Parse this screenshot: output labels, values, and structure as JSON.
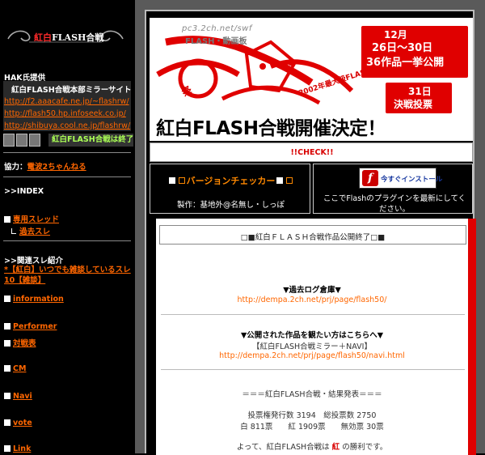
{
  "sidebar": {
    "logo_text_red": "紅白",
    "logo_text": "FLASH合戦",
    "provider": "HAK氏提供",
    "mirror_title": "紅白FLASH合戦本部ミラーサイト",
    "mirror_links": [
      "http://f2.aaacafe.ne.jp/~flashrw/",
      "http://flash50.hp.infoseek.co.jp/",
      "http://shibuya.cool.ne.jp/flashrw/"
    ],
    "ticker": "紅白FLASH合戦は終了しました",
    "cooperation_label": "協力：",
    "cooperation_link": "電波2ちゃんねる",
    "index_heading": ">>INDEX",
    "thread_item": "専用スレッド",
    "thread_sub": "過去スレ",
    "related_heading": ">>関連スレ紹介",
    "related_link": "*【紅白】いつでも雑談しているスレ10【雑談】",
    "nav_items": [
      "information",
      "Performer",
      "対戦表",
      "CM",
      "Navi",
      "vote",
      "Link"
    ]
  },
  "banner": {
    "tag1": "pc3.2ch.net/swf",
    "tag2": "FLASH・動画板",
    "sai": "祭",
    "promo": "2002年最大級FLASHイベントの予感だよ!!",
    "date_month": "12月",
    "date_range": "26日〜30日",
    "date_desc": "36作品一挙公開",
    "final_day": "31日",
    "final_vote": "決戦投票",
    "main_title": "紅白FLASH合戦開催決定！"
  },
  "check_label": "!!CHECK!!",
  "version_checker": {
    "title": "バージョンチェッカー",
    "author": "製作：基地外@名無し・しっぽ"
  },
  "install": {
    "logo": "f",
    "button_label": "今すぐインストール",
    "text": "ここでFlashのプラグインを最新にしてください。"
  },
  "content": {
    "header": "□■紅白ＦＬＡＳＨ合戦作品公開終了□■",
    "archive_heading": "▼過去ログ倉庫▼",
    "archive_link": "http://dempa.2ch.net/prj/page/flash50/",
    "view_heading": "▼公開された作品を観たい方はこちらへ▼",
    "view_sub": "【紅白FLASH合戦ミラー＋NAVI】",
    "view_link": "http://dempa.2ch.net/prj/page/flash50/navi.html",
    "results_heading": "＝＝＝紅白FLASH合戦・結果発表＝＝＝",
    "results_line1": "投票権発行数 3194　総投票数 2750",
    "results_line2": "白 811票　　紅 1909票　　無効票 30票",
    "conclusion_pre": "よって、紅白FLASH合戦は",
    "conclusion_red": "紅",
    "conclusion_post": "の勝利です。"
  },
  "colors": {
    "link": "#ff6600",
    "accent_red": "#e00000",
    "ticker": "#aaff55"
  }
}
